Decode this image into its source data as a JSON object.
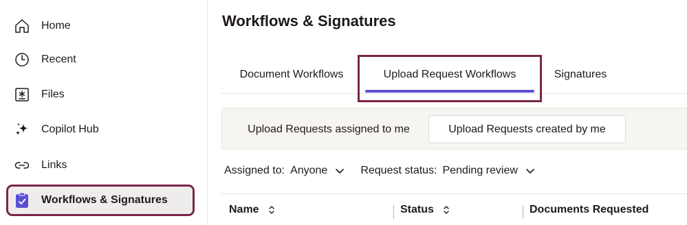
{
  "sidebar": {
    "items": [
      {
        "label": "Home",
        "icon": "home-icon"
      },
      {
        "label": "Recent",
        "icon": "clock-icon"
      },
      {
        "label": "Files",
        "icon": "files-icon"
      },
      {
        "label": "Copilot Hub",
        "icon": "sparkle-icon"
      },
      {
        "label": "Links",
        "icon": "link-icon"
      },
      {
        "label": "Workflows & Signatures",
        "icon": "clipboard-check-icon",
        "active": true
      }
    ]
  },
  "main": {
    "title": "Workflows & Signatures",
    "tabs": [
      {
        "label": "Document Workflows"
      },
      {
        "label": "Upload Request Workflows",
        "active": true
      },
      {
        "label": "Signatures"
      }
    ],
    "segments": [
      {
        "label": "Upload Requests assigned to me"
      },
      {
        "label": "Upload Requests created by me",
        "selected": true
      }
    ],
    "filters": [
      {
        "label": "Assigned to:",
        "value": "Anyone"
      },
      {
        "label": "Request status:",
        "value": "Pending review"
      }
    ],
    "columns": [
      "Name",
      "Status",
      "Documents Requested"
    ]
  },
  "colors": {
    "accent": "#5b4fd6",
    "highlight_outline": "#7a2448",
    "text": "#1e1919",
    "active_bg": "#efedeb"
  }
}
